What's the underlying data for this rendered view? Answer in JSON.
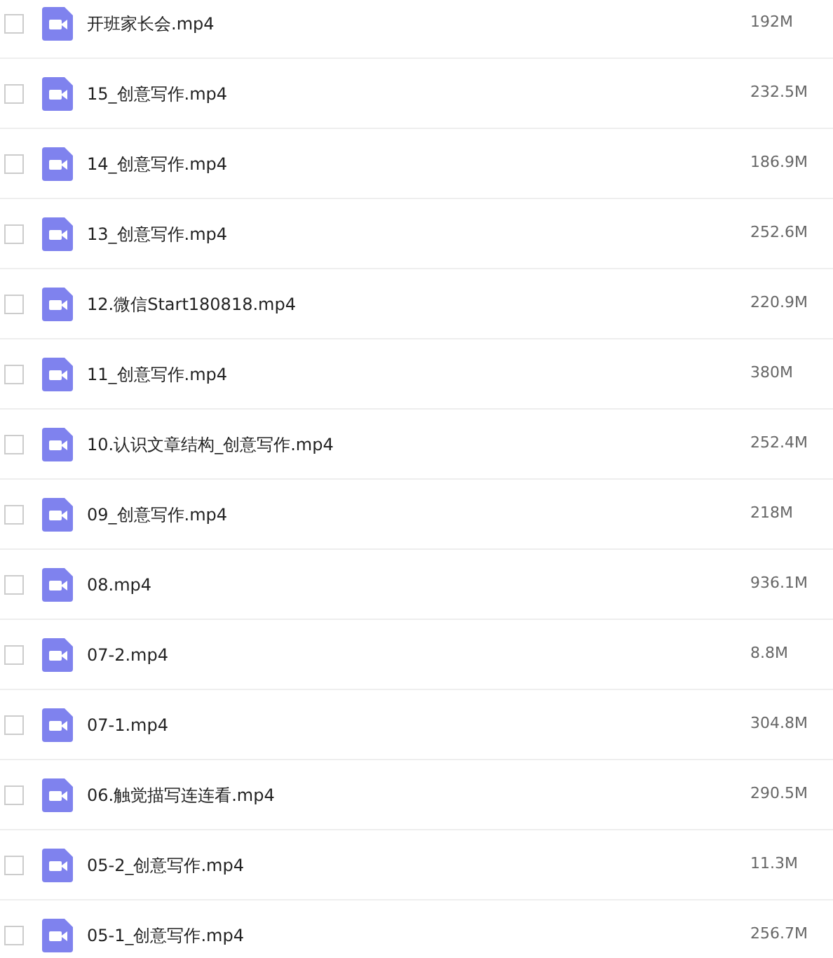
{
  "files": [
    {
      "name": "开班家长会.mp4",
      "size": "192M",
      "checked": false
    },
    {
      "name": "15_创意写作.mp4",
      "size": "232.5M",
      "checked": false
    },
    {
      "name": "14_创意写作.mp4",
      "size": "186.9M",
      "checked": false
    },
    {
      "name": "13_创意写作.mp4",
      "size": "252.6M",
      "checked": false
    },
    {
      "name": "12.微信Start180818.mp4",
      "size": "220.9M",
      "checked": false
    },
    {
      "name": "11_创意写作.mp4",
      "size": "380M",
      "checked": false
    },
    {
      "name": "10.认识文章结构_创意写作.mp4",
      "size": "252.4M",
      "checked": false
    },
    {
      "name": "09_创意写作.mp4",
      "size": "218M",
      "checked": false
    },
    {
      "name": "08.mp4",
      "size": "936.1M",
      "checked": false
    },
    {
      "name": "07-2.mp4",
      "size": "8.8M",
      "checked": false
    },
    {
      "name": "07-1.mp4",
      "size": "304.8M",
      "checked": false
    },
    {
      "name": "06.触觉描写连连看.mp4",
      "size": "290.5M",
      "checked": false
    },
    {
      "name": "05-2_创意写作.mp4",
      "size": "11.3M",
      "checked": false
    },
    {
      "name": "05-1_创意写作.mp4",
      "size": "256.7M",
      "checked": false
    }
  ]
}
